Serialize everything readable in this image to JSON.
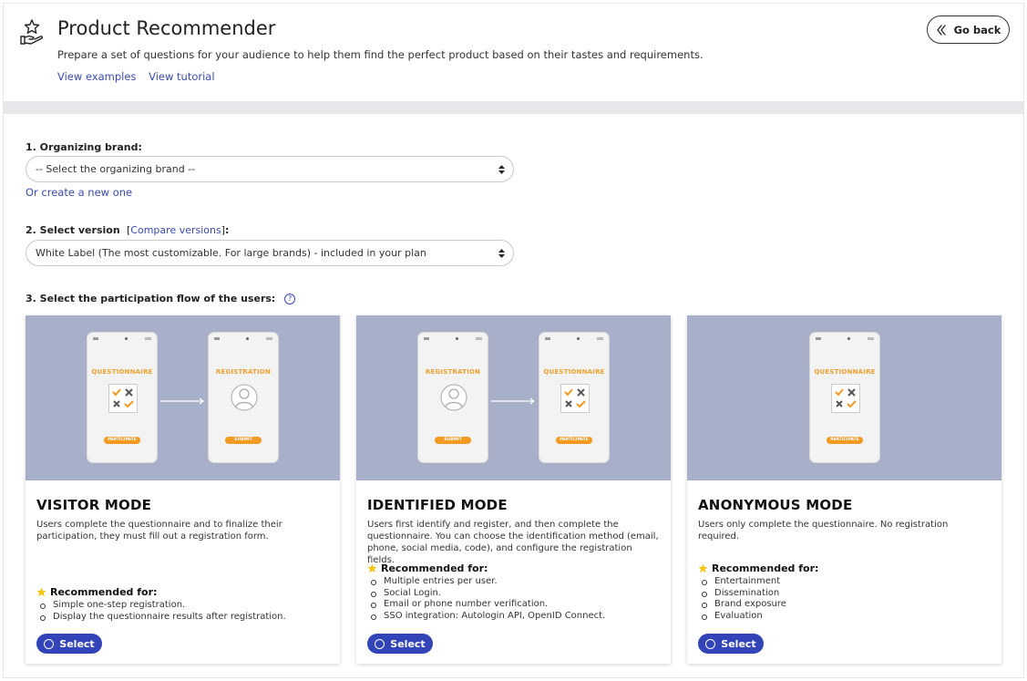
{
  "header": {
    "title": "Product Recommender",
    "subtitle": "Prepare a set of questions for your audience to help them find the perfect product based on their tastes and requirements.",
    "links": [
      "View examples",
      "View tutorial"
    ],
    "go_back": "Go back"
  },
  "form": {
    "brand": {
      "label": "1. Organizing brand:",
      "selected": "-- Select the organizing brand --",
      "create_link": "Or create a new one"
    },
    "version": {
      "label": "2. Select version",
      "compare_link": "Compare versions",
      "selected": "White Label (The most customizable. For large brands) - included in your plan"
    },
    "flow": {
      "label": "3. Select the participation flow of the users:"
    }
  },
  "phone_labels": {
    "questionnaire": "QUESTIONNAIRE",
    "registration": "REGISTRATION",
    "participate": "PARTICIPATE",
    "submit": "SUBMIT"
  },
  "cards": [
    {
      "title": "VISITOR MODE",
      "description": "Users complete the questionnaire and to finalize their participation, they must fill out a registration form.",
      "recommended_label": "Recommended for:",
      "recommended": [
        "Simple one-step registration.",
        "Display the questionnaire results after registration."
      ],
      "button": "Select"
    },
    {
      "title": "IDENTIFIED MODE",
      "description": "Users first identify and register, and then complete the questionnaire. You can choose the identification method (email, phone, social media, code), and configure the registration fields.",
      "recommended_label": "Recommended for:",
      "recommended": [
        "Multiple entries per user.",
        "Social Login.",
        "Email or phone number verification.",
        "SSO integration: Autologin API, OpenID Connect."
      ],
      "button": "Select"
    },
    {
      "title": "ANONYMOUS MODE",
      "description": "Users only complete the questionnaire. No registration required.",
      "recommended_label": "Recommended for:",
      "recommended": [
        "Entertainment",
        "Dissemination",
        "Brand exposure",
        "Evaluation"
      ],
      "button": "Select"
    }
  ],
  "colors": {
    "accent": "#3343b8",
    "link": "#3a4bb3",
    "illustration_bg": "#a7b0c8",
    "orange": "#f39a22",
    "star": "#f5c518"
  }
}
